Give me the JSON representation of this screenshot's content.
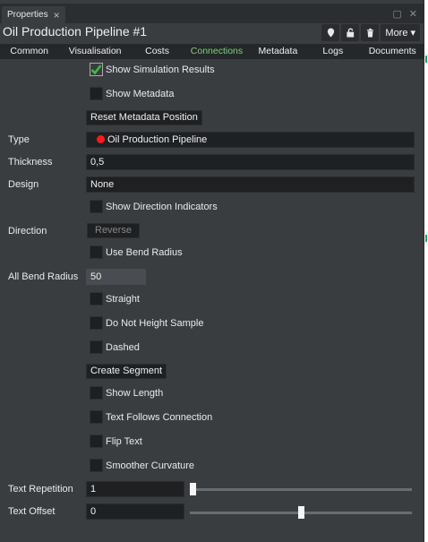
{
  "tab": {
    "label": "Properties"
  },
  "title": "Oil Production Pipeline #1",
  "more_label": "More",
  "categories": [
    "Common",
    "Visualisation",
    "Costs",
    "Connections",
    "Metadata",
    "Logs",
    "Documents"
  ],
  "active_category": "Connections",
  "fields": {
    "show_simulation_results": {
      "label": "Show Simulation Results",
      "checked": true
    },
    "show_metadata": {
      "label": "Show Metadata",
      "checked": false
    },
    "reset_metadata_position": "Reset Metadata Position",
    "type": {
      "label": "Type",
      "value": "Oil Production Pipeline",
      "color": "#ff1b1b"
    },
    "thickness": {
      "label": "Thickness",
      "value": "0,5"
    },
    "design": {
      "label": "Design",
      "value": "None"
    },
    "show_direction_indicators": {
      "label": "Show Direction Indicators",
      "checked": false
    },
    "direction": {
      "label": "Direction",
      "button": "Reverse"
    },
    "use_bend_radius": {
      "label": "Use Bend Radius",
      "checked": false
    },
    "all_bend_radius": {
      "label": "All Bend Radius",
      "value": "50"
    },
    "straight": {
      "label": "Straight",
      "checked": false
    },
    "do_not_height_sample": {
      "label": "Do Not Height Sample",
      "checked": false
    },
    "dashed": {
      "label": "Dashed",
      "checked": false
    },
    "create_segment": "Create Segment",
    "show_length": {
      "label": "Show Length",
      "checked": false
    },
    "text_follows_connection": {
      "label": "Text Follows Connection",
      "checked": false
    },
    "flip_text": {
      "label": "Flip Text",
      "checked": false
    },
    "smoother_curvature": {
      "label": "Smoother Curvature",
      "checked": false
    },
    "text_repetition": {
      "label": "Text Repetition",
      "value": "1",
      "slider_fraction": 0.0
    },
    "text_offset": {
      "label": "Text Offset",
      "value": "0",
      "slider_fraction": 0.5
    }
  },
  "colors": {
    "panel_bg": "#3a3d40",
    "accent_active_tab": "#7fd07a",
    "check_green": "#3fbf3f"
  }
}
